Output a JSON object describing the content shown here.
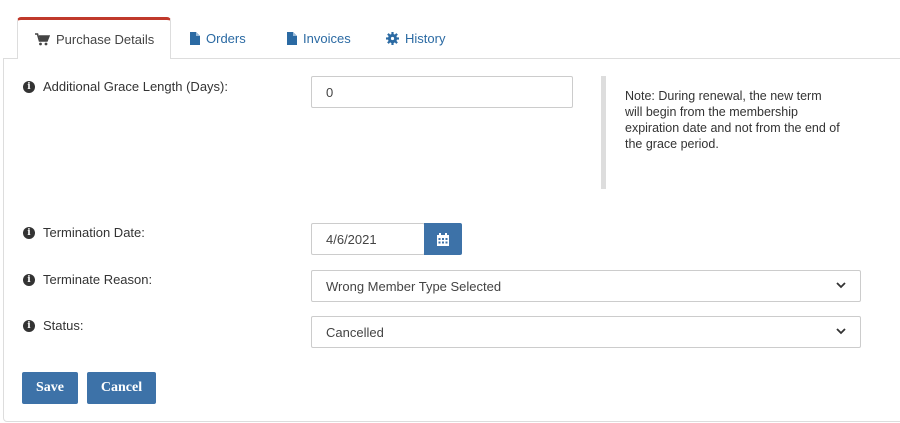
{
  "tabs": [
    {
      "label": "Purchase Details",
      "icon": "cart-icon",
      "active": true
    },
    {
      "label": "Orders",
      "icon": "file-icon",
      "active": false
    },
    {
      "label": "Invoices",
      "icon": "file-icon",
      "active": false
    },
    {
      "label": "History",
      "icon": "gear-icon",
      "active": false
    }
  ],
  "form": {
    "grace_label": "Additional Grace Length (Days):",
    "grace_value": "0",
    "note": "Note: During renewal, the new term will begin from the membership expiration date and not from the end of the grace period.",
    "termination_label": "Termination Date:",
    "termination_value": "4/6/2021",
    "reason_label": "Terminate Reason:",
    "reason_value": "Wrong Member Type Selected",
    "status_label": "Status:",
    "status_value": "Cancelled"
  },
  "actions": {
    "save_label": "Save",
    "cancel_label": "Cancel"
  },
  "colors": {
    "accent": "#3d72a8",
    "active_tab_border": "#c0392b",
    "link": "#2b6aa3"
  }
}
